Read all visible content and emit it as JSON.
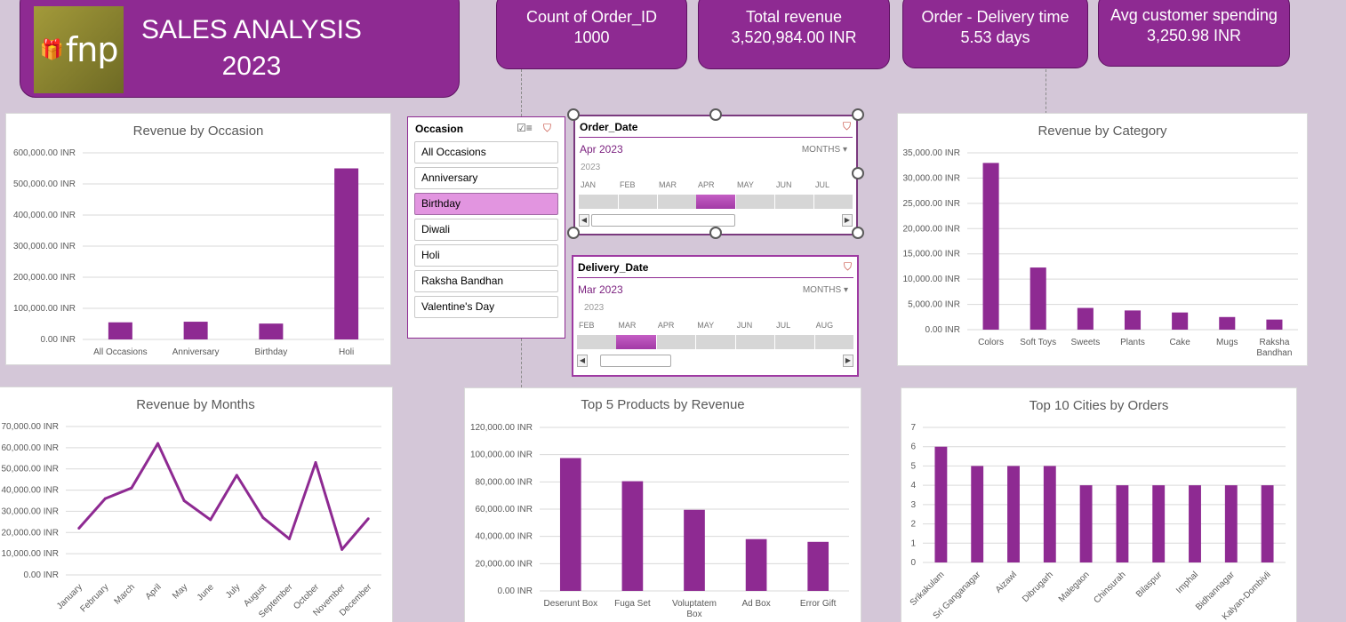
{
  "header": {
    "logo_text": "fnp",
    "title_line1": "SALES ANALYSIS",
    "title_line2": "2023"
  },
  "kpis": [
    {
      "label": "Count of Order_ID",
      "value": "1000"
    },
    {
      "label": "Total revenue",
      "value": "3,520,984.00 INR"
    },
    {
      "label": "Order - Delivery time",
      "value": "5.53 days"
    },
    {
      "label": "Avg customer spending",
      "value": "3,250.98 INR"
    }
  ],
  "occasion_slicer": {
    "header": "Occasion",
    "items": [
      "All Occasions",
      "Anniversary",
      "Birthday",
      "Diwali",
      "Holi",
      "Raksha Bandhan",
      "Valentine's Day"
    ],
    "selected": "Birthday"
  },
  "timeline_order": {
    "header": "Order_Date",
    "period": "Apr 2023",
    "level": "MONTHS",
    "year": "2023",
    "months": [
      "JAN",
      "FEB",
      "MAR",
      "APR",
      "MAY",
      "JUN",
      "JUL"
    ],
    "selected_index": 3
  },
  "timeline_delivery": {
    "header": "Delivery_Date",
    "period": "Mar 2023",
    "level": "MONTHS",
    "year": "2023",
    "months": [
      "FEB",
      "MAR",
      "APR",
      "MAY",
      "JUN",
      "JUL",
      "AUG"
    ],
    "selected_index": 1
  },
  "colors": {
    "accent": "#8e2a92",
    "background": "#d4c7d8",
    "grid": "#d9d9d9"
  },
  "chart_data": [
    {
      "id": "occasion",
      "type": "bar",
      "title": "Revenue by Occasion",
      "categories": [
        "All Occasions",
        "Anniversary",
        "Birthday",
        "Holi"
      ],
      "values": [
        55000,
        57000,
        51000,
        550000
      ],
      "ylim": [
        0,
        600000
      ],
      "yticks": [
        0,
        100000,
        200000,
        300000,
        400000,
        500000,
        600000
      ],
      "ytick_labels": [
        "0.00 INR",
        "100,000.00 INR",
        "200,000.00 INR",
        "300,000.00 INR",
        "400,000.00 INR",
        "500,000.00 INR",
        "600,000.00 INR"
      ]
    },
    {
      "id": "category",
      "type": "bar",
      "title": "Revenue by Category",
      "categories": [
        "Colors",
        "Soft Toys",
        "Sweets",
        "Plants",
        "Cake",
        "Mugs",
        "Raksha Bandhan"
      ],
      "values": [
        33000,
        12300,
        4300,
        3800,
        3400,
        2500,
        2000
      ],
      "ylim": [
        0,
        35000
      ],
      "yticks": [
        0,
        5000,
        10000,
        15000,
        20000,
        25000,
        30000,
        35000
      ],
      "ytick_labels": [
        "0.00 INR",
        "5,000.00 INR",
        "10,000.00 INR",
        "15,000.00 INR",
        "20,000.00 INR",
        "25,000.00 INR",
        "30,000.00 INR",
        "35,000.00 INR"
      ]
    },
    {
      "id": "months",
      "type": "line",
      "title": "Revenue by Months",
      "categories": [
        "January",
        "February",
        "March",
        "April",
        "May",
        "June",
        "July",
        "August",
        "September",
        "October",
        "November",
        "December"
      ],
      "values": [
        22000,
        36000,
        41000,
        62000,
        35000,
        26000,
        47000,
        27000,
        17000,
        53000,
        12000,
        26500
      ],
      "ylim": [
        0,
        70000
      ],
      "yticks": [
        0,
        10000,
        20000,
        30000,
        40000,
        50000,
        60000,
        70000
      ],
      "ytick_labels": [
        "0.00 INR",
        "10,000.00 INR",
        "20,000.00 INR",
        "30,000.00 INR",
        "40,000.00 INR",
        "50,000.00 INR",
        "60,000.00 INR",
        "70,000.00 INR"
      ]
    },
    {
      "id": "products",
      "type": "bar",
      "title": "Top 5 Products by Revenue",
      "categories": [
        "Deserunt Box",
        "Fuga Set",
        "Voluptatem Box",
        "Ad Box",
        "Error Gift"
      ],
      "values": [
        97500,
        80500,
        59500,
        38000,
        36000
      ],
      "ylim": [
        0,
        120000
      ],
      "yticks": [
        0,
        20000,
        40000,
        60000,
        80000,
        100000,
        120000
      ],
      "ytick_labels": [
        "0.00 INR",
        "20,000.00 INR",
        "40,000.00 INR",
        "60,000.00 INR",
        "80,000.00 INR",
        "100,000.00 INR",
        "120,000.00 INR"
      ]
    },
    {
      "id": "cities",
      "type": "bar",
      "title": "Top 10 Cities by Orders",
      "categories": [
        "Srikakulam",
        "Sri Ganganagar",
        "Aizawl",
        "Dibrugarh",
        "Malegaon",
        "Chinsurah",
        "Bilaspur",
        "Imphal",
        "Bidhannagar",
        "Kalyan-Dombivli"
      ],
      "values": [
        6,
        5,
        5,
        5,
        4,
        4,
        4,
        4,
        4,
        4
      ],
      "ylim": [
        0,
        7
      ],
      "yticks": [
        0,
        1,
        2,
        3,
        4,
        5,
        6,
        7
      ],
      "ytick_labels": [
        "0",
        "1",
        "2",
        "3",
        "4",
        "5",
        "6",
        "7"
      ]
    }
  ]
}
